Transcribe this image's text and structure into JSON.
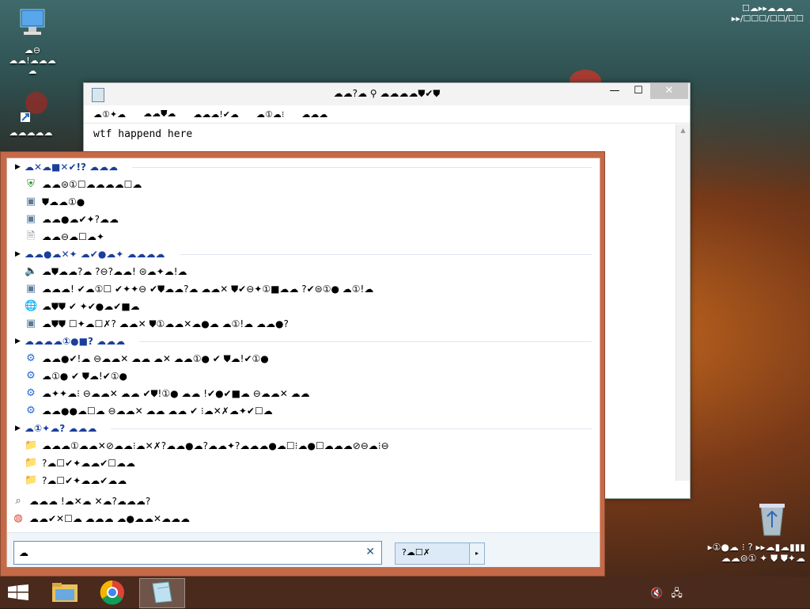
{
  "desktop": {
    "icons": [
      {
        "label": "☁⊖\n☁☁!☁☁☁☁"
      },
      {
        "label": "☁☁☁☁☁"
      }
    ],
    "watermark_line1": "▸①●☁ ⁝ ?  ▸▸☁▮☁▮▮▮",
    "watermark_line2": "☁☁⊜① ✦ ⛊  ⛊✦☁"
  },
  "notepad": {
    "title": "☁☁?☁ ⚲ ☁☁☁☁⛊✔⛊",
    "menu": [
      "☁①✦☁",
      "☁☁⛊☁",
      "☁☁☁!✔☁",
      "☁①☁⁝",
      "☁☁☁"
    ],
    "text": "wtf happend here",
    "controls": {
      "minimize": "—",
      "maximize": "☐",
      "close": "✕"
    }
  },
  "launcher": {
    "groups": [
      {
        "title": "☁✕☁■✕✔!? ☁☁☁",
        "items": [
          {
            "icon": "shield-check-icon",
            "glyph": "⛨",
            "label": "☁☁⊜①☐☁☁☁☁☐☁"
          },
          {
            "icon": "window-icon",
            "glyph": "▣",
            "label": "⛊☁☁①●"
          },
          {
            "icon": "window-icon",
            "glyph": "▣",
            "label": "☁☁●☁✔✦?☁☁"
          },
          {
            "icon": "file-icon",
            "glyph": "🗎",
            "label": "☁☁⊖☁☐☁✦"
          }
        ]
      },
      {
        "title": "☁☁●☁✕✦ ☁✔●☁✦ ☁☁☁☁",
        "items": [
          {
            "icon": "speaker-icon",
            "glyph": "🔈",
            "label": "☁⛊☁☁?☁ ?⊖?☁☁! ⊜☁✦☁!☁"
          },
          {
            "icon": "window-icon",
            "glyph": "▣",
            "label": "☁☁☁! ✔☁①☐ ✔✦✦⊖ ✔⛊☁☁?☁ ☁☁✕ ⛊✔⊖✦①■☁☁ ?✔⊜①● ☁①!☁"
          },
          {
            "icon": "globe-icon",
            "glyph": "🌐",
            "label": "☁⛊⛊ ✔ ✦✔●☁✔■☁"
          },
          {
            "icon": "window-icon",
            "glyph": "▣",
            "label": "☁⛊⛊ ☐✦☁☐✗? ☁☁✕ ⛊①☁☁✕☁●☁ ☁①!☁ ☁☁●?"
          }
        ]
      },
      {
        "title": "☁☁☁☁①●■? ☁☁☁",
        "items": [
          {
            "icon": "gear-icon",
            "glyph": "⚙",
            "label": "☁☁●✔!☁ ⊖☁☁✕ ☁☁ ☁✕ ☁☁①● ✔ ⛊☁!✔①●"
          },
          {
            "icon": "gear-icon",
            "glyph": "⚙",
            "label": "☁①● ✔ ⛊☁!✔①●"
          },
          {
            "icon": "gear-icon",
            "glyph": "⚙",
            "label": "☁✦✦☁⁝ ⊖☁☁✕ ☁☁ ✔⛊!①● ☁☁ !✔●✔■☁ ⊖☁☁✕ ☁☁"
          },
          {
            "icon": "gear-icon",
            "glyph": "⚙",
            "label": "☁☁●●☁☐☁ ⊖☁☁✕ ☁☁ ☁☁ ✔ ⁝☁✕✗☁✦✔☐☁"
          }
        ]
      },
      {
        "title": "☁①✦☁? ☁☁☁",
        "items": [
          {
            "icon": "folder-icon",
            "glyph": "📁",
            "label": "☁☁☁①☁☁✕⊘☁☁⁝☁✕✗?☁☁●☁?☁☁✦?☁☁☁●☁☐⁝☁●☐☁☁☁⊘⊖☁⁝⊖"
          },
          {
            "icon": "folder-icon",
            "glyph": "📁",
            "label": "?☁☐✔✦☁☁✔☐☁☁"
          },
          {
            "icon": "folder-icon",
            "glyph": "📁",
            "label": "?☁☐✔✦☁☁✔☁☁"
          }
        ]
      }
    ],
    "extra_items": [
      {
        "icon": "magnifier-icon",
        "glyph": "⌕",
        "label": "☁☁☁ !☁✕☁ ✕☁?☁☁☁?"
      },
      {
        "icon": "chrome-icon",
        "glyph": "◍",
        "label": "☁☁✔✕☐☁ ☁☁☁ ☁●☁☁✕☁☁☁"
      }
    ],
    "search": {
      "value": "☁",
      "placeholder": ""
    },
    "clear_glyph": "✕",
    "options_label": "?☁☐✗",
    "options_arrow": "▸"
  },
  "tray": {
    "time": "☐☁▸▸☁☁☁",
    "date": "▸▸/☐☐☐/☐☐/☐☐"
  },
  "colors": {
    "launcher_frame": "#c46a48",
    "group_title": "#1a3f9a"
  }
}
